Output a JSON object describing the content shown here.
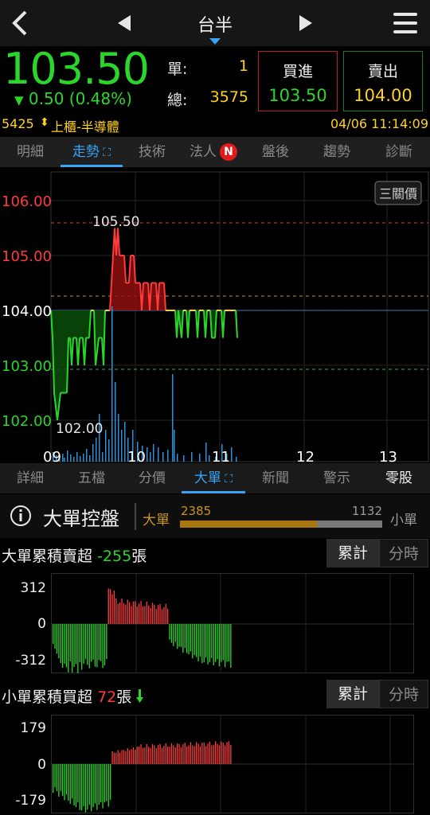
{
  "header": {
    "title": "台半"
  },
  "quote": {
    "price": "103.50",
    "change": "0.50 (0.48%)",
    "unit_label": "單:",
    "unit_value": "1",
    "total_label": "總:",
    "total_value": "3575",
    "buy_label": "買進",
    "buy_price": "103.50",
    "sell_label": "賣出",
    "sell_price": "104.00",
    "code": "5425",
    "market": "上櫃-半導體",
    "datetime": "04/06 11:14:09"
  },
  "tabs_top": [
    "明細",
    "走勢",
    "技術",
    "法人",
    "盤後",
    "趨勢",
    "診斷"
  ],
  "tabs_top_active": 1,
  "badge_new": "N",
  "chart": {
    "three_price_label": "三關價",
    "y_labels": [
      {
        "v": "106.00",
        "c": "#ff3b3b"
      },
      {
        "v": "105.00",
        "c": "#ff3b3b"
      },
      {
        "v": "104.00",
        "c": "#ffffff"
      },
      {
        "v": "103.00",
        "c": "#2bd62b"
      },
      {
        "v": "102.00",
        "c": "#2bd62b"
      }
    ],
    "x_labels": [
      "09",
      "10",
      "11",
      "12",
      "13"
    ],
    "high_label": "105.50",
    "low_label": "102.00"
  },
  "tabs_bottom": [
    "詳細",
    "五檔",
    "分價",
    "大單",
    "新聞",
    "警示",
    "零股"
  ],
  "tabs_bottom_active": 3,
  "bigorder": {
    "title": "大單控盤",
    "big_label": "大單",
    "big_value": "2385",
    "small_value": "1132",
    "small_label": "小單",
    "big_ratio": 0.678
  },
  "panel1": {
    "title": "大單累積賣超",
    "value": "-255",
    "unit": "張",
    "btn_cum": "累計",
    "btn_time": "分時",
    "y_labels": [
      "312",
      "0",
      "-312"
    ]
  },
  "panel2": {
    "title": "小單累積買超",
    "value": "72",
    "unit": "張",
    "btn_cum": "累計",
    "btn_time": "分時",
    "y_labels": [
      "179",
      "0",
      "-179"
    ]
  },
  "colors": {
    "up": "#ff3b3b",
    "down": "#2bd62b",
    "accent": "#37a4f5",
    "yellow": "#ffd21e"
  }
}
